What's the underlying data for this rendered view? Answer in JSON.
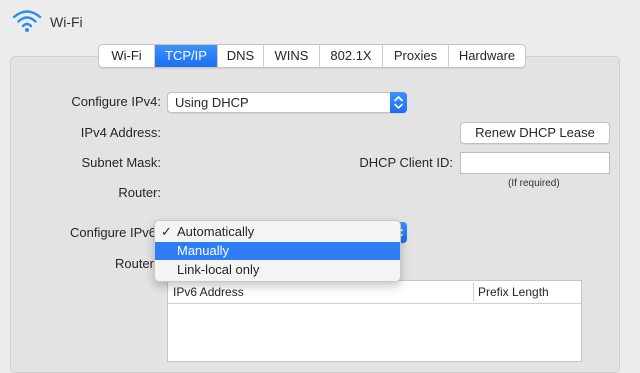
{
  "header": {
    "title": "Wi-Fi",
    "icon": "wifi-icon"
  },
  "tabs": [
    {
      "label": "Wi-Fi",
      "active": false
    },
    {
      "label": "TCP/IP",
      "active": true
    },
    {
      "label": "DNS",
      "active": false
    },
    {
      "label": "WINS",
      "active": false
    },
    {
      "label": "802.1X",
      "active": false
    },
    {
      "label": "Proxies",
      "active": false
    },
    {
      "label": "Hardware",
      "active": false
    }
  ],
  "ipv4": {
    "configure_label": "Configure IPv4:",
    "configure_value": "Using DHCP",
    "address_label": "IPv4 Address:",
    "subnet_label": "Subnet Mask:",
    "router_label": "Router:",
    "renew_button": "Renew DHCP Lease",
    "client_id_label": "DHCP Client ID:",
    "client_id_value": "",
    "client_id_hint": "(If required)"
  },
  "ipv6": {
    "configure_label": "Configure IPv6",
    "router_label": "Router",
    "menu": {
      "items": [
        {
          "label": "Automatically",
          "checked": true,
          "highlighted": false
        },
        {
          "label": "Manually",
          "checked": false,
          "highlighted": true
        },
        {
          "label": "Link-local only",
          "checked": false,
          "highlighted": false
        }
      ],
      "check_glyph": "✓"
    },
    "table": {
      "columns": [
        "IPv6 Address",
        "Prefix Length"
      ]
    }
  },
  "colors": {
    "accent": "#1b6ef3",
    "highlight": "#2e7cf6"
  }
}
